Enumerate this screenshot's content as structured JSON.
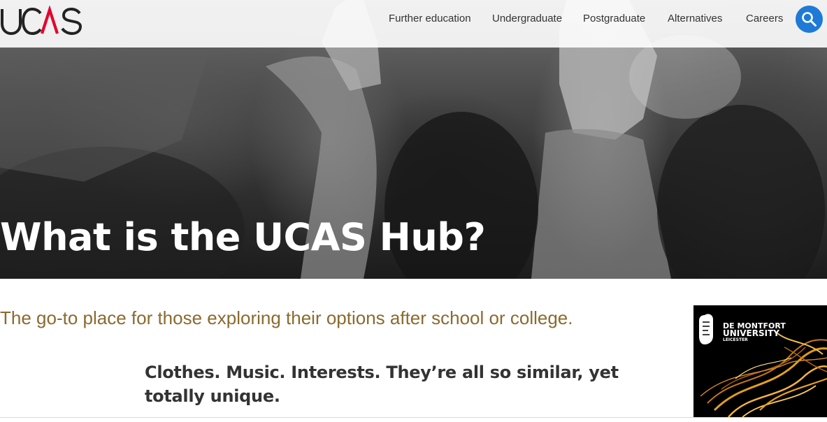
{
  "header": {
    "logo_text": "UCAS",
    "nav": [
      {
        "label": "Further education"
      },
      {
        "label": "Undergraduate"
      },
      {
        "label": "Postgraduate"
      },
      {
        "label": "Alternatives"
      },
      {
        "label": "Careers"
      }
    ],
    "search_icon": "search-icon"
  },
  "hero": {
    "title": "What is the UCAS Hub?"
  },
  "intro": "The go-to place for those exploring their options after school or college.",
  "feature_heading": "Clothes. Music. Interests. They’re all so similar, yet totally unique.",
  "ad": {
    "brand_line1": "DE MONTFORT",
    "brand_line2": "UNIVERSITY",
    "brand_line3": "LEICESTER"
  },
  "colors": {
    "brand_red": "#e4032e",
    "search_blue": "#1e7ad6",
    "intro_gold": "#8a6a2f",
    "ad_gold": "#e8a21c"
  }
}
